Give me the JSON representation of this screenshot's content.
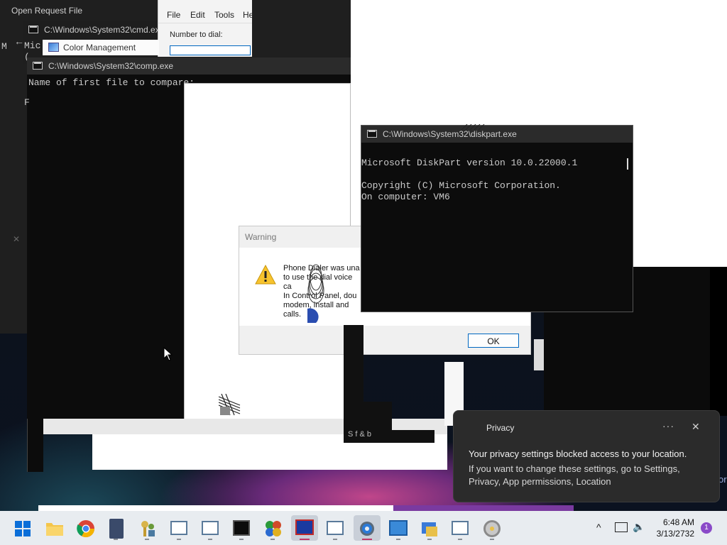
{
  "open_request": {
    "title": "Open Request File"
  },
  "dialer": {
    "menu": [
      "File",
      "Edit",
      "Tools",
      "He"
    ],
    "number_label": "Number to dial:"
  },
  "cmd_window": {
    "title": "C:\\Windows\\System32\\cmd.exe",
    "text_line1": "Mic",
    "text_line2": "(",
    "text_line3": "M"
  },
  "color_mgmt": {
    "title": "Color Management"
  },
  "comp_window": {
    "title": "C:\\Windows\\System32\\comp.exe",
    "prompt": "Name of first file to compare:",
    "fragment": "F"
  },
  "warning_dialog": {
    "title": "Warning",
    "message_lines": [
      "Phone Dialer was una",
      "to use the dial voice ca",
      "In Control Panel, dou",
      "modem, install and",
      "calls."
    ],
    "ok_label": "OK"
  },
  "diskpart": {
    "title": "C:\\Windows\\System32\\diskpart.exe",
    "line1": "Microsoft DiskPart version 10.0.22000.1",
    "line2": "Copyright (C) Microsoft Corporation.",
    "line3": "On computer: VM6"
  },
  "glitch_text": "S  f  & b",
  "privacy_toast": {
    "app": "Privacy",
    "heading": "Your privacy settings blocked access to your location.",
    "body": "If you want to change these settings, go to Settings, Privacy, App permissions, Location",
    "more": "···",
    "close": "✕"
  },
  "right_fragment": "or",
  "taskbar": {
    "icons": [
      "windows-start-icon",
      "file-explorer-icon",
      "chrome-icon",
      "calculator-icon",
      "key-users-icon",
      "app-window-icon",
      "app-window-icon",
      "cmd-icon",
      "puzzle-icon",
      "display-icon",
      "app-window-icon",
      "settings-gear-icon",
      "remote-desktop-icon",
      "control-panel-icon",
      "app-window-icon",
      "dvd-icon"
    ],
    "time": "6:48 AM",
    "date": "3/13/2732",
    "badge": "1"
  },
  "colors": {
    "accent": "#0067c0",
    "console_bg": "#0c0c0c",
    "toast_bg": "#2b2b2b"
  }
}
